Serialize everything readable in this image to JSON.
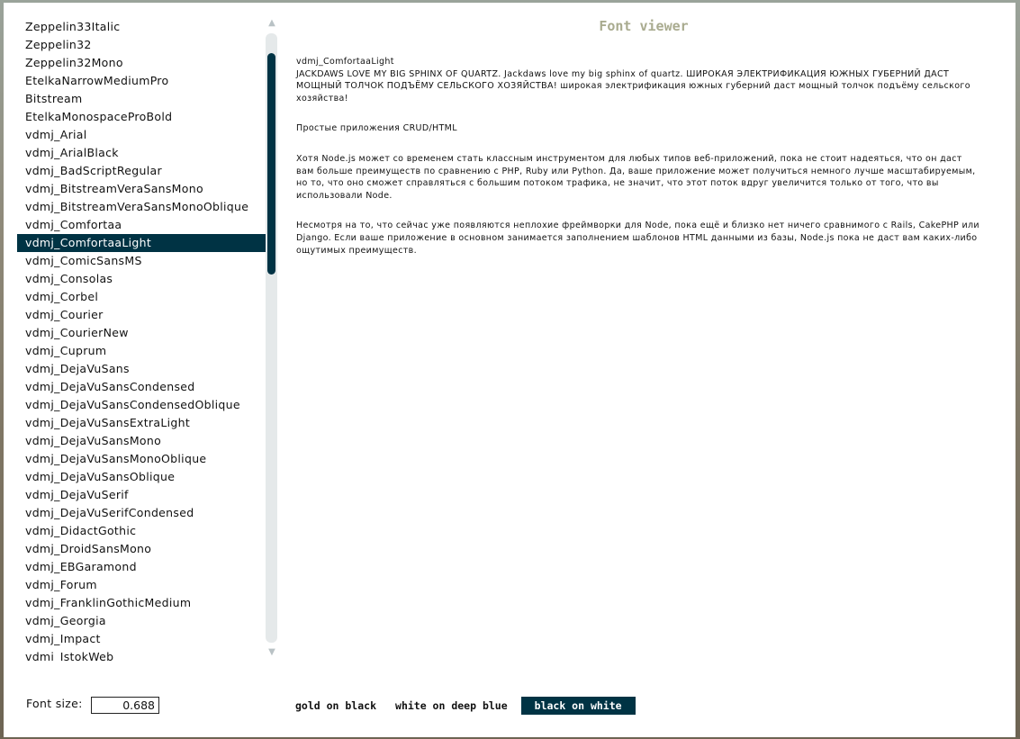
{
  "font_list": {
    "items": [
      "Zeppelin33Italic",
      "Zeppelin32",
      "Zeppelin32Mono",
      "EtelkaNarrowMediumPro",
      "Bitstream",
      "EtelkaMonospaceProBold",
      "vdmj_Arial",
      "vdmj_ArialBlack",
      "vdmj_BadScriptRegular",
      "vdmj_BitstreamVeraSansMono",
      "vdmj_BitstreamVeraSansMonoOblique",
      "vdmj_Comfortaa",
      "vdmj_ComfortaaLight",
      "vdmj_ComicSansMS",
      "vdmj_Consolas",
      "vdmj_Corbel",
      "vdmj_Courier",
      "vdmj_CourierNew",
      "vdmj_Cuprum",
      "vdmj_DejaVuSans",
      "vdmj_DejaVuSansCondensed",
      "vdmj_DejaVuSansCondensedOblique",
      "vdmj_DejaVuSansExtraLight",
      "vdmj_DejaVuSansMono",
      "vdmj_DejaVuSansMonoOblique",
      "vdmj_DejaVuSansOblique",
      "vdmj_DejaVuSerif",
      "vdmj_DejaVuSerifCondensed",
      "vdmj_DidactGothic",
      "vdmj_DroidSansMono",
      "vdmj_EBGaramond",
      "vdmj_Forum",
      "vdmj_FranklinGothicMedium",
      "vdmj_Georgia",
      "vdmj_Impact",
      "vdmj_IstokWeb"
    ],
    "selected": "vdmj_ComfortaaLight"
  },
  "scrollbar": {
    "up_icon": "▲",
    "down_icon": "▼"
  },
  "viewer": {
    "title": "Font viewer",
    "font_name": "vdmj_ComfortaaLight",
    "pangram": "JACKDAWS LOVE MY BIG SPHINX OF QUARTZ. Jackdaws love my big sphinx of quartz. ШИРОКАЯ ЭЛЕКТРИФИКАЦИЯ ЮЖНЫХ ГУБЕРНИЙ ДАСТ МОЩНЫЙ ТОЛЧОК ПОДЪЁМУ СЕЛЬСКОГО ХОЗЯЙСТВА! широкая электрификация южных губерний даст мощный толчок подъёму сельского хозяйства!",
    "heading": "Простые приложения CRUD/HTML",
    "paragraph1": "Хотя Node.js может со временем стать классным инструментом для любых типов веб-приложений, пока не стоит надеяться, что он даст вам больше преимуществ по сравнению с PHP, Ruby или Python. Да, ваше приложение может получиться немного лучше масштабируемым, но то, что оно сможет справляться с большим потоком трафика, не значит, что этот поток вдруг увеличится только от того, что вы использовали Node.",
    "paragraph2": "Несмотря на то, что сейчас уже появляются неплохие фреймворки для Node, пока ещё и близко нет ничего сравнимого с Rails, CakePHP или Django. Если ваше приложение в основном занимается заполнением шаблонов HTML данными из базы, Node.js пока не даст вам каких-либо ощутимых преимуществ."
  },
  "controls": {
    "font_size_label": "Font size:",
    "font_size_value": "0.688",
    "themes": [
      {
        "label": "gold on black",
        "active": false
      },
      {
        "label": "white on deep blue",
        "active": false
      },
      {
        "label": "black on white",
        "active": true
      }
    ]
  },
  "colors": {
    "accent": "#003344",
    "title": "#a9ab8f",
    "scroll_track": "#e5e9ea"
  }
}
